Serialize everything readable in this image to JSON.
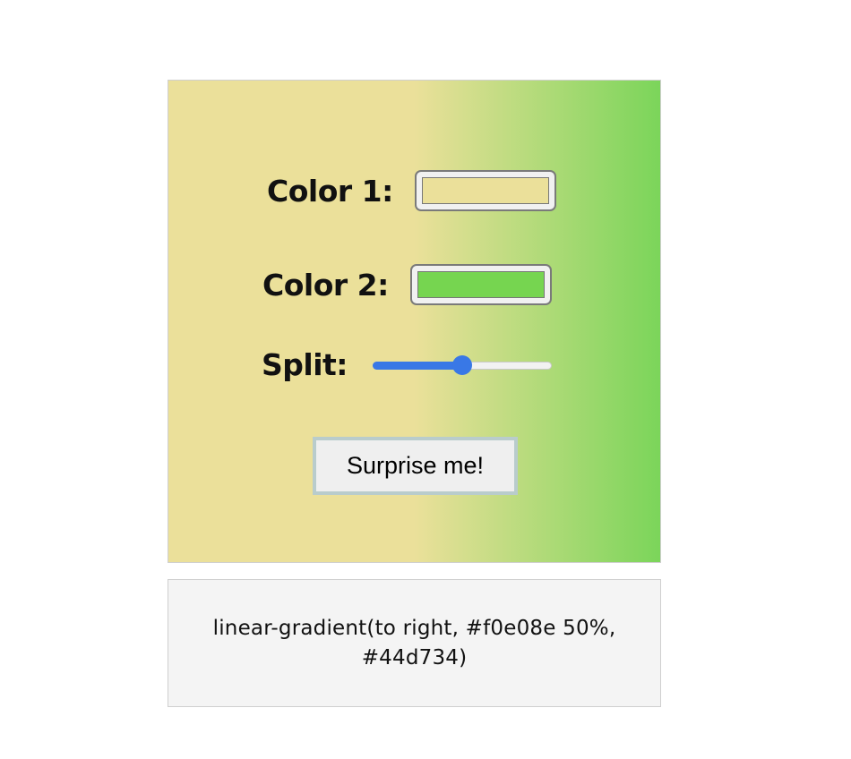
{
  "controls": {
    "color1": {
      "label": "Color 1:",
      "value": "#f0e08e",
      "swatch_color": "#ebe09a"
    },
    "color2": {
      "label": "Color 2:",
      "value": "#44d734",
      "swatch_color": "#76d550"
    },
    "split": {
      "label": "Split:",
      "value": 50,
      "min": 0,
      "max": 100
    }
  },
  "button": {
    "label": "Surprise me!"
  },
  "output": {
    "css": "linear-gradient(to right, #f0e08e 50%, #44d734)"
  },
  "colors": {
    "slider_accent": "#3978e6"
  }
}
